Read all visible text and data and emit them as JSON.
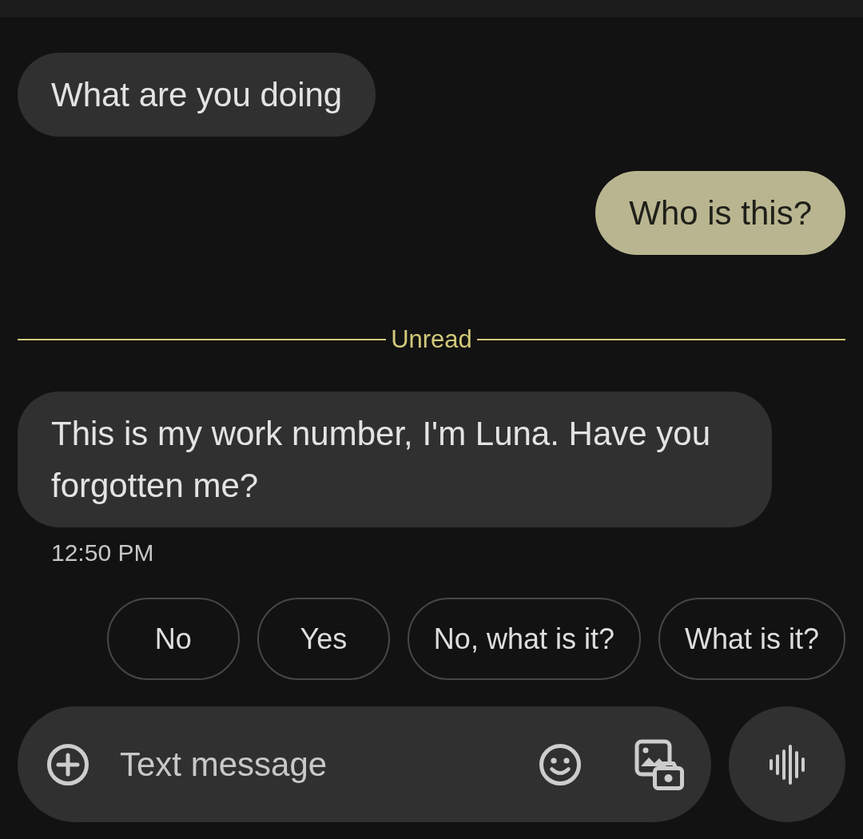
{
  "messages": [
    {
      "kind": "incoming",
      "text": "What are you doing"
    },
    {
      "kind": "outgoing",
      "text": "Who is this?"
    },
    {
      "kind": "divider",
      "text": "Unread"
    },
    {
      "kind": "incoming",
      "text": "This is my work number, I'm Luna. Have you forgotten me?",
      "timestamp": "12:50 PM"
    }
  ],
  "smart_replies": [
    "No",
    "Yes",
    "No, what is it?",
    "What is it?"
  ],
  "compose": {
    "placeholder": "Text message"
  }
}
